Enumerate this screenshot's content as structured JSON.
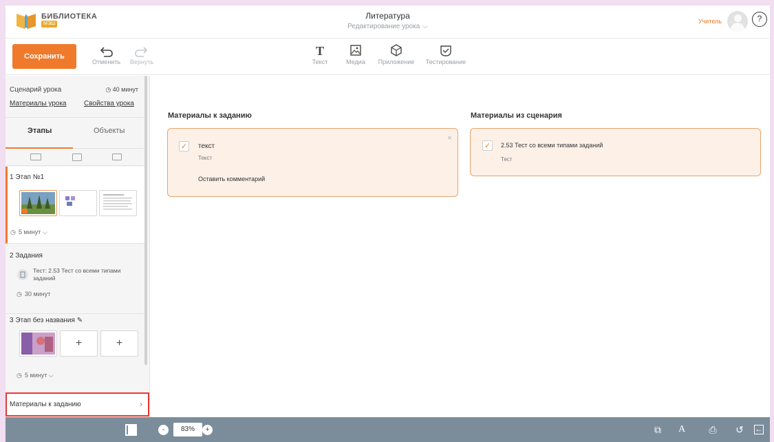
{
  "header": {
    "logo_title": "БИБЛИОТЕКА",
    "logo_sub": "МЭШ",
    "title": "Литература",
    "subtitle": "Редактирование урока",
    "role": "Учитель",
    "help": "?"
  },
  "toolbar": {
    "save": "Сохранить",
    "undo": "Отменить",
    "redo": "Вернуть",
    "text": "Текст",
    "media": "Медиа",
    "app": "Приложение",
    "test": "Тестирование"
  },
  "sidebar": {
    "scenario_label": "Сценарий урока",
    "scenario_time": "40 минут",
    "materials_link": "Материалы урока",
    "props_link": "Свойства урока",
    "tab_stages": "Этапы",
    "tab_objects": "Объекты",
    "stages": [
      {
        "num": "1",
        "title": "Этап №1",
        "duration": "5  минут"
      },
      {
        "num": "2",
        "title": "Задания",
        "task": "Тест: 2.53 Тест со всеми типами заданий",
        "duration": "30 минут"
      },
      {
        "num": "3",
        "title": "Этап без названия",
        "duration": "5  минут"
      }
    ],
    "bottom_label": "Материалы к заданию"
  },
  "main": {
    "left_header": "Материалы к заданию",
    "left_card": {
      "title": "текст",
      "type": "Текст",
      "comment": "Оставить комментарий"
    },
    "right_header": "Материалы из сценария",
    "right_card": {
      "title": "2.53 Тест со всеми типами заданий",
      "type": "Тест"
    }
  },
  "bottombar": {
    "zoom": "83%"
  },
  "colors": {
    "accent": "#ef7a2c",
    "card_bg": "#fdf0e7",
    "bottombar": "#7b8d9b",
    "highlight": "#e53935"
  }
}
